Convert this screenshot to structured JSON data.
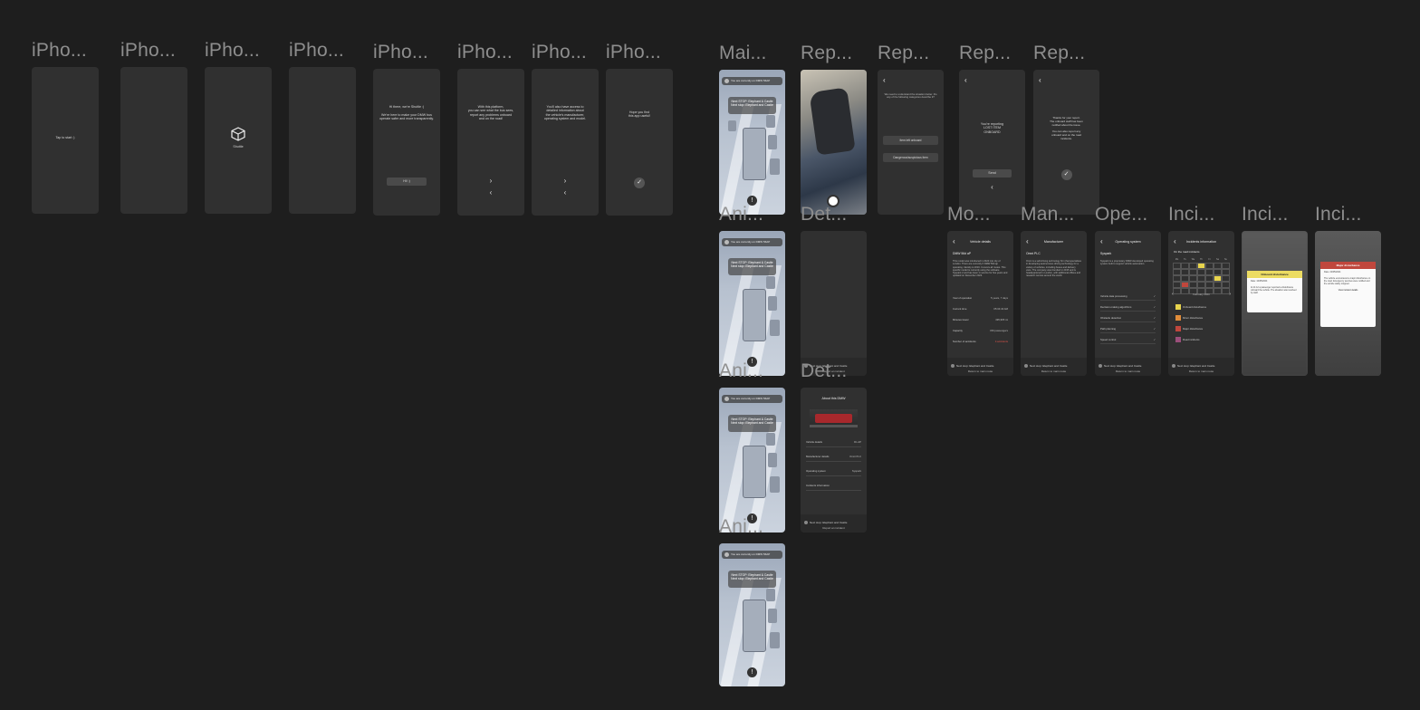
{
  "frame_labels": {
    "iphone": "iPho...",
    "main": "Mai...",
    "report": "Rep...",
    "animation": "Ani...",
    "details": "Det...",
    "model": "Mo...",
    "manufacturer": "Man...",
    "operating_system": "Ope...",
    "incidents": "Inci..."
  },
  "onboarding": {
    "tap_to_start": "Tap to start :)",
    "logo_label": "Shuttle",
    "intro": "Hi there, we're Shuttle :)\n\nWe're here to make your DMW bus operate safer and more transparently.",
    "intro_button": "Hi! :)",
    "platform": "With this platform,\nyou can see what the bus sees,\nreport any problems onboard\nand on the road!",
    "access": "You'll also have access to\ndetailed information about\nthe vehicle's manufacturer,\noperating system and model.",
    "farewell": "Hope you find\nthis app useful!",
    "next_icon": "›",
    "prev_icon": "‹",
    "check_icon": "✓"
  },
  "main": {
    "topbar": "You are currently on DMW 56AP",
    "banner": "Next STOP: Elephant & Castle\nNext stop: Elephant and Castle",
    "warn_icon": "!"
  },
  "report": {
    "question": "We need to understand the situation better. Do any of the following categories describe it?",
    "options": [
      "Item left onboard",
      "Dangerous/suspicious item"
    ],
    "reporting": "You're reporting\nLOST ITEM\nONBOARD",
    "send": "Send",
    "thanks": "Thanks for your report.\nThe onboard staff has been\nnotified about the issue.\n\nYou can also report any\nonboard and on the road\nincidents."
  },
  "details": {
    "next_stop_row": "Next stop: Elephant and Castle",
    "footer": "Report an incident",
    "about_title": "About this DMW",
    "rows": [
      {
        "label": "Vehicle details",
        "value": "DL AP"
      },
      {
        "label": "Manufacturer details",
        "value": "Omni PLC"
      },
      {
        "label": "Operating system",
        "value": "Syspark"
      },
      {
        "label": "Incidents information",
        "value": ""
      }
    ]
  },
  "model": {
    "header": "Vehicle details",
    "title": "DMW 56d aP",
    "body": "This model was introduced in 2024 into city of London. There are currently 6 DMW 56d ap operating. Identity is 2019. It covers all routes. This specific model is currently using the software Syspark 2 and has been in service for five years and updated on December 2023.",
    "rows": [
      {
        "label": "Year of operation",
        "value": "5 years, 7 days"
      },
      {
        "label": "Current time",
        "value": "05:34:43 AM"
      },
      {
        "label": "Minutes travel",
        "value": "495,965 mi"
      },
      {
        "label": "Capacity",
        "value": "150 passengers"
      },
      {
        "label": "Number of accidents",
        "value": "4 accidents"
      }
    ],
    "next_stop_row": "Next stop: Elephant and Castle",
    "footer": "Return to main route"
  },
  "manufacturer": {
    "header": "Manufacturer",
    "title": "Omni PLC",
    "body": "Omni is a self-driving technology firm that specialises in developing autonomous driving technology for a variety of vehicles, including buses and delivery vans. The company was founded in 2015 and is headquartered in London, with additional offices and research centres around the world.",
    "next_stop_row": "Next stop: Elephant and Castle",
    "footer": "Return to main route"
  },
  "operating_system": {
    "header": "Operating system",
    "title": "Syspark",
    "body": "Syspark is a proprietary DMW-developed operating system built to support vehicle automation.",
    "rows": [
      "Vehicle data processing",
      "Decision-making algorithms",
      "Obstacle detection",
      "Path planning",
      "Speed control"
    ],
    "next_stop_row": "Next stop: Elephant and Castle",
    "footer": "Return to main route"
  },
  "incidents": {
    "header": "Incidents information",
    "subtitle": "On the road incidents",
    "month": "February 2024",
    "weekdays": [
      "Mo",
      "Tu",
      "We",
      "Th",
      "Fr",
      "Sa",
      "Su"
    ],
    "legend": [
      "Onboard disturbance",
      "Minor disturbance",
      "Major disturbance",
      "Road incidents"
    ],
    "legend_colors": [
      "#e8d44d",
      "#e08c3a",
      "#c0473d",
      "#9b4e7a"
    ],
    "next_stop_row": "Next stop: Elephant and Castle",
    "footer": "Return to main route",
    "modal_onboard": {
      "title": "Onboard disturbance",
      "date": "Date: 10/05/2024",
      "body": "At 11:12 a passenger reported a disturbance onboard the vehicle. The situation was resolved by staff."
    },
    "modal_major": {
      "title": "Major disturbance",
      "date": "Date: 22/05/2024",
      "body": "The vehicle encountered a major disturbance on the road. Emergency services were notified and the vehicle safely stopped.",
      "link": "View incident details"
    }
  }
}
